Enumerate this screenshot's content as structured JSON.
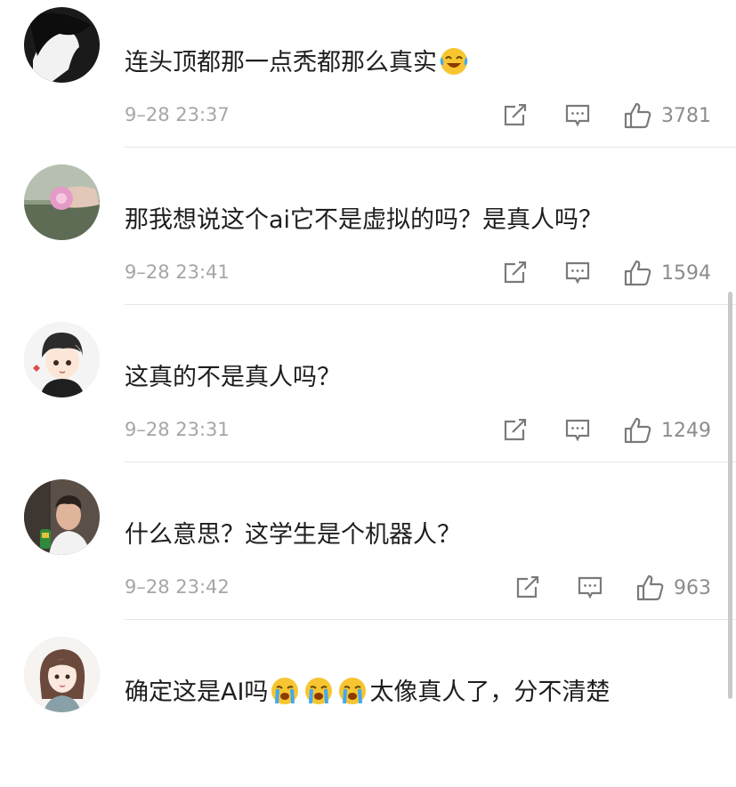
{
  "comments": [
    {
      "text": "连头顶都那一点秃都那么真实",
      "emoji_after": "laughing-tears-emoji",
      "time": "9–28 23:37",
      "likes": "3781"
    },
    {
      "text": "那我想说这个ai它不是虚拟的吗？是真人吗？",
      "time": "9–28 23:41",
      "likes": "1594"
    },
    {
      "text": "这真的不是真人吗？",
      "time": "9–28 23:31",
      "likes": "1249"
    },
    {
      "text": "什么意思？这学生是个机器人？",
      "time": "9–28 23:42",
      "likes": "963"
    },
    {
      "text_part1": "确定这是AI吗",
      "emoji_inline": [
        "crying-emoji",
        "crying-emoji",
        "crying-emoji"
      ],
      "text_part2": "太像真人了，分不清楚"
    }
  ],
  "icons": {
    "share": "share-icon",
    "reply": "comment-icon",
    "like": "thumbs-up-icon"
  },
  "colors": {
    "text": "#1e1e1e",
    "meta": "#a6a6a6",
    "divider": "#e6e6e6"
  }
}
